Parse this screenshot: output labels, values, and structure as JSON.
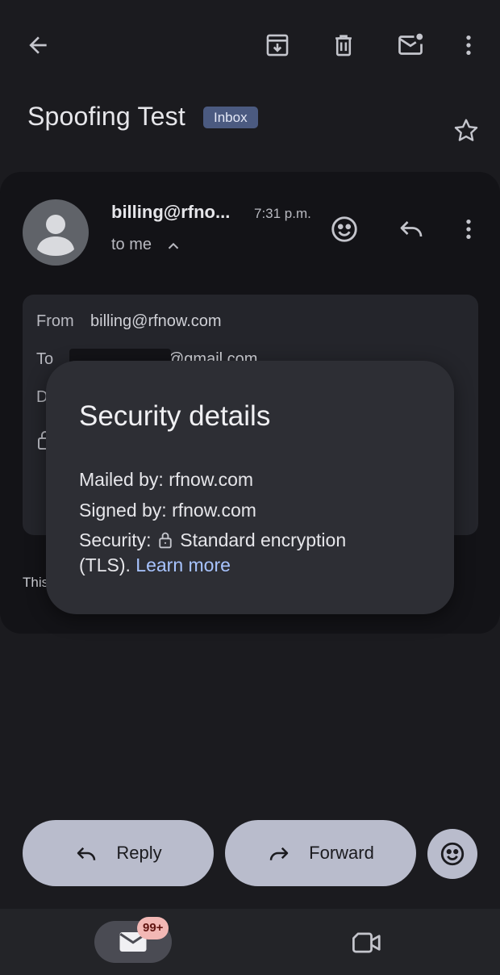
{
  "header": {
    "back_icon": "arrow-left-icon",
    "actions": [
      "archive-icon",
      "trash-icon",
      "mark-unread-icon",
      "more-vert-icon"
    ]
  },
  "thread": {
    "subject": "Spoofing Test",
    "label": "Inbox",
    "star_icon": "star-outline-icon"
  },
  "message": {
    "sender": "billing@rfno...",
    "time": "7:31 p.m.",
    "to_line": "to me",
    "details": {
      "from_label": "From",
      "from_value": "billing@rfnow.com",
      "to_label": "To",
      "to_value": "@gmail.com",
      "date_label": "D"
    },
    "body_preview": "This"
  },
  "security_popup": {
    "title": "Security details",
    "mailed_by": "Mailed by: rfnow.com",
    "signed_by": "Signed by: rfnow.com",
    "security_label": "Security:",
    "security_value": "Standard encryption",
    "security_value_cont": "(TLS).",
    "learn_more": "Learn more"
  },
  "actions": {
    "reply": "Reply",
    "forward": "Forward"
  },
  "bottom_nav": {
    "mail_badge": "99+",
    "items": [
      "mail-icon",
      "video-icon"
    ]
  },
  "colors": {
    "background": "#1b1b1f",
    "card": "#131317",
    "popup": "#2d2e34",
    "link": "#a8c4ff",
    "chip": "#4b5a80",
    "pill_button": "#b9bccc",
    "badge": "#f2b8b5"
  }
}
